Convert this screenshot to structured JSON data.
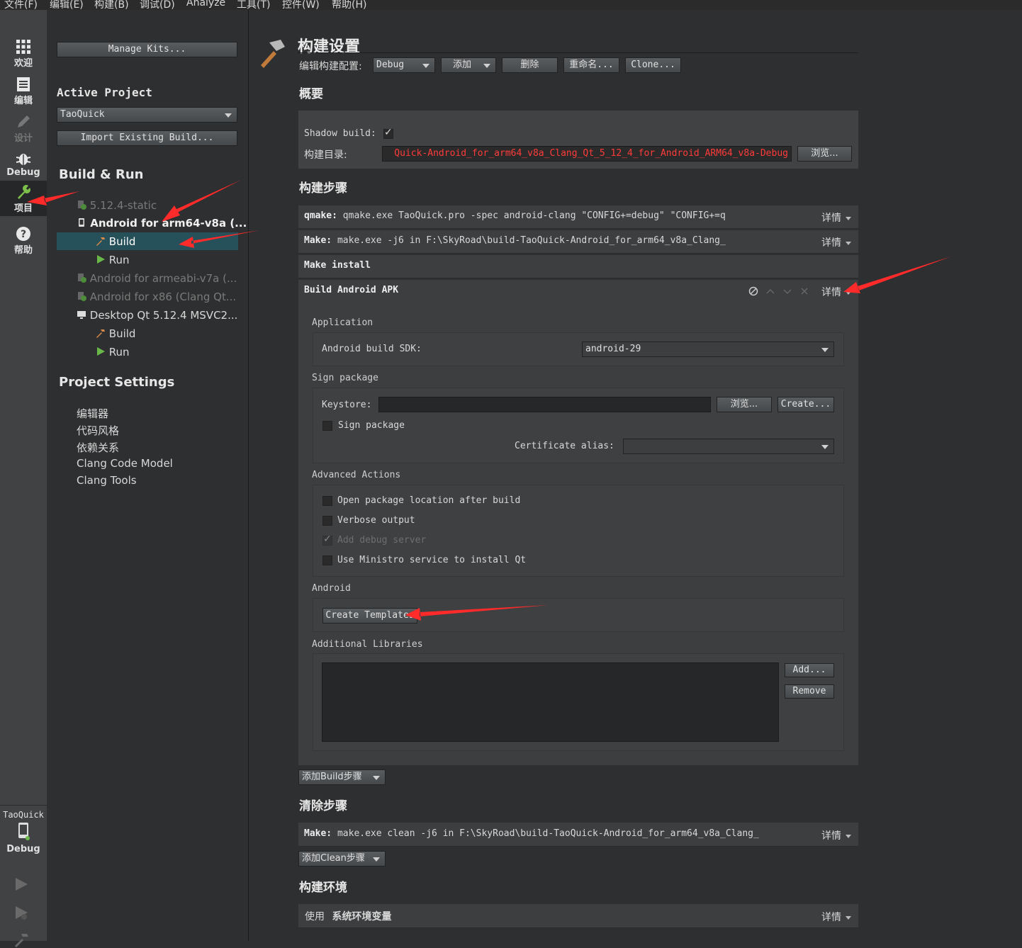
{
  "menu": [
    "文件(F)",
    "编辑(E)",
    "构建(B)",
    "调试(D)",
    "Analyze",
    "工具(T)",
    "控件(W)",
    "帮助(H)"
  ],
  "modes": [
    {
      "label": "欢迎",
      "icon": "grid-icon"
    },
    {
      "label": "编辑",
      "icon": "document-icon"
    },
    {
      "label": "设计",
      "icon": "pencil-icon"
    },
    {
      "label": "Debug",
      "icon": "bug-icon"
    },
    {
      "label": "项目",
      "icon": "wrench-icon"
    },
    {
      "label": "帮助",
      "icon": "help-icon"
    }
  ],
  "target": {
    "project": "TaoQuick",
    "mode": "Debug"
  },
  "left": {
    "manage_kits": "Manage Kits...",
    "active_project_heading": "Active Project",
    "active_project": "TaoQuick",
    "import_build": "Import Existing Build...",
    "build_run_heading": "Build & Run",
    "kits": [
      {
        "label": "5.12.4-static"
      },
      {
        "label": "Android for arm64-v8a (..."
      },
      {
        "label": "Build"
      },
      {
        "label": "Run"
      },
      {
        "label": "Android for armeabi-v7a (..."
      },
      {
        "label": "Android for x86 (Clang Qt..."
      },
      {
        "label": "Desktop Qt 5.12.4 MSVC2..."
      },
      {
        "label": "Build"
      },
      {
        "label": "Run"
      }
    ],
    "project_settings_heading": "Project Settings",
    "settings": [
      "编辑器",
      "代码风格",
      "依赖关系",
      "Clang Code Model",
      "Clang Tools"
    ]
  },
  "main": {
    "title": "构建设置",
    "edit_config_label": "编辑构建配置:",
    "config_value": "Debug",
    "add": "添加",
    "delete": "删除",
    "rename": "重命名...",
    "clone": "Clone...",
    "overview": "概要",
    "shadow_build_label": "Shadow build:",
    "build_dir_label": "构建目录:",
    "build_dir_value": "Quick-Android_for_arm64_v8a_Clang_Qt_5_12_4_for_Android_ARM64_v8a-Debug",
    "browse": "浏览...",
    "build_steps": "构建步骤",
    "details": "详情",
    "steps": [
      {
        "name": "qmake:",
        "desc": "qmake.exe TaoQuick.pro -spec android-clang \"CONFIG+=debug\" \"CONFIG+=q"
      },
      {
        "name": "Make:",
        "desc": "make.exe -j6 in F:\\SkyRoad\\build-TaoQuick-Android_for_arm64_v8a_Clang_"
      },
      {
        "name": "Make install",
        "desc": ""
      },
      {
        "name": "Build Android APK",
        "desc": ""
      }
    ],
    "apk": {
      "application": "Application",
      "sdk_label": "Android build SDK:",
      "sdk_value": "android-29",
      "sign_package_group": "Sign package",
      "keystore_label": "Keystore:",
      "browse": "浏览...",
      "create": "Create...",
      "sign_package_check": "Sign package",
      "cert_alias_label": "Certificate alias:",
      "advanced_actions": "Advanced Actions",
      "open_pkg": "Open package location after build",
      "verbose": "Verbose output",
      "add_debug_server": "Add debug server",
      "ministro": "Use Ministro service to install Qt",
      "android": "Android",
      "create_templates": "Create Templates",
      "additional_libraries": "Additional Libraries",
      "add": "Add...",
      "remove": "Remove"
    },
    "add_build_step": "添加Build步骤",
    "clean_steps": "清除步骤",
    "clean_step": {
      "name": "Make:",
      "desc": "make.exe clean -j6 in F:\\SkyRoad\\build-TaoQuick-Android_for_arm64_v8a_Clang_"
    },
    "add_clean_step": "添加Clean步骤",
    "build_env": "构建环境",
    "env_use": "使用",
    "env_value": "系统环境变量"
  }
}
